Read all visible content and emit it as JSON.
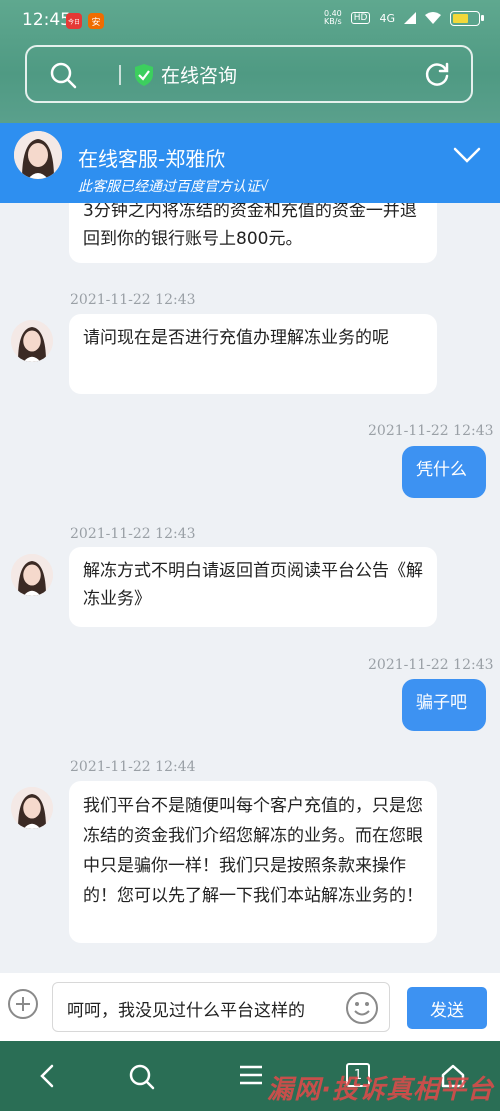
{
  "status_bar": {
    "time": "12:45",
    "badge1": "今日",
    "badge2": "安",
    "net_speed": "0.40",
    "net_unit": "KB/s",
    "hd": "HD",
    "signal": "4G"
  },
  "search_bar": {
    "title": "在线咨询"
  },
  "agent": {
    "name": "在线客服-郑雅欣",
    "verify": "此客服已经通过百度官方认证√"
  },
  "messages": [
    {
      "side": "agent",
      "text": "3分钟之内将冻结的资金和充值的资金一并退回到你的银行账号上800元。"
    },
    {
      "side": "agent",
      "time": "2021-11-22  12:43",
      "text": "请问现在是否进行充值办理解冻业务的呢"
    },
    {
      "side": "me",
      "time": "2021-11-22  12:43",
      "text": "凭什么"
    },
    {
      "side": "agent",
      "time": "2021-11-22  12:43",
      "text": "解冻方式不明白请返回首页阅读平台公告《解冻业务》"
    },
    {
      "side": "me",
      "time": "2021-11-22  12:43",
      "text": "骗子吧"
    },
    {
      "side": "agent",
      "time": "2021-11-22  12:44",
      "text": "我们平台不是随便叫每个客户充值的，只是您冻结的资金我们介绍您解冻的业务。而在您眼中只是骗你一样！我们只是按照条款来操作的！您可以先了解一下我们本站解冻业务的！"
    }
  ],
  "input": {
    "value": "呵呵，我没见过什么平台这样的",
    "send_label": "发送"
  },
  "navbar": {
    "tab_count": "1",
    "watermark": "漏网·投诉真相平台"
  },
  "colors": {
    "brand_blue": "#2e8ff0",
    "bubble_blue": "#3d92f2",
    "header_green": "#5fa88f"
  }
}
